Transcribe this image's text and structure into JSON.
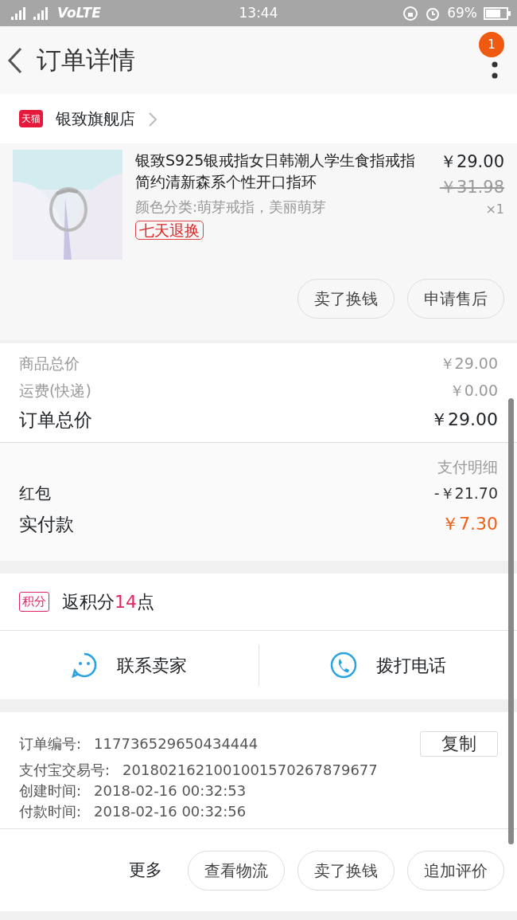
{
  "status_bar": {
    "network": "VoLTE",
    "time": "13:44",
    "battery": "69%"
  },
  "header": {
    "title": "订单详情",
    "notification_count": "1"
  },
  "shop": {
    "badge": "天猫",
    "name": "银致旗舰店"
  },
  "product": {
    "image": {
      "kind": "picture"
    },
    "title": "银致S925银戒指女日韩潮人学生食指戒指简约清新森系个性开口指环",
    "price": "￥29.00",
    "original_price": "￥31.98",
    "variant": "颜色分类:萌芽戒指，美丽萌芽",
    "quantity": "×1",
    "tag": "七天退换",
    "buttons": [
      "卖了换钱",
      "申请售后"
    ]
  },
  "totals": [
    {
      "label": "商品总价",
      "value": "￥29.00",
      "kind": "minor"
    },
    {
      "label": "运费(快递)",
      "value": "￥0.00",
      "kind": "minor"
    },
    {
      "label": "订单总价",
      "value": "￥29.00",
      "kind": "major"
    }
  ],
  "payment": {
    "heading": "支付明细",
    "rows": [
      {
        "label": "红包",
        "value": "-￥21.70",
        "kind": "normal"
      },
      {
        "label": "实付款",
        "value": "￥7.30",
        "kind": "paid"
      }
    ]
  },
  "points": {
    "badge": "积分",
    "text_before": "返积分",
    "amount": "14",
    "text_after": "点"
  },
  "contact": [
    "联系卖家",
    "拨打电话"
  ],
  "order_info": {
    "copy_button": "复制",
    "rows": [
      {
        "label": "订单编号:",
        "value": "117736529650434444"
      },
      {
        "label": "支付宝交易号:",
        "value": "2018021621001001570267879677"
      },
      {
        "label": "创建时间:",
        "value": "2018-02-16 00:32:53"
      },
      {
        "label": "付款时间:",
        "value": "2018-02-16 00:32:56"
      }
    ]
  },
  "bottom_bar": {
    "more": "更多",
    "buttons": [
      "查看物流",
      "卖了换钱",
      "追加评价"
    ]
  }
}
